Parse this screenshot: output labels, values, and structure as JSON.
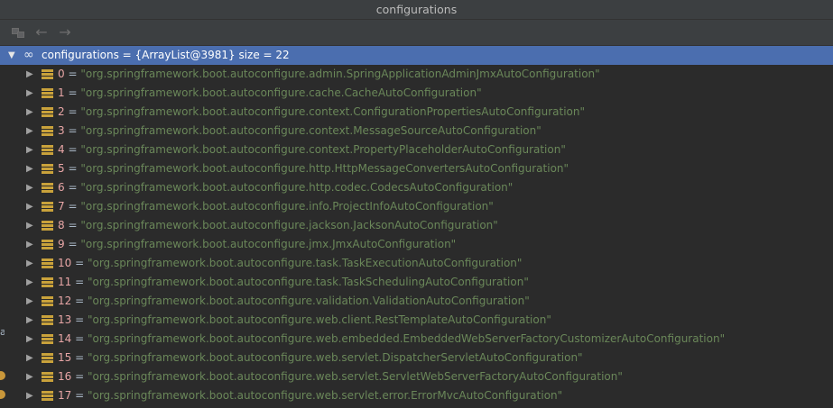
{
  "window": {
    "title": "configurations"
  },
  "toolbar": {
    "icons": [
      "frames-icon",
      "back-arrow-icon",
      "forward-arrow-icon"
    ]
  },
  "root": {
    "expanded": true,
    "label": "configurations = {ArrayList@3981}  size = 22"
  },
  "items": [
    {
      "index": "0",
      "value": "\"org.springframework.boot.autoconfigure.admin.SpringApplicationAdminJmxAutoConfiguration\""
    },
    {
      "index": "1",
      "value": "\"org.springframework.boot.autoconfigure.cache.CacheAutoConfiguration\""
    },
    {
      "index": "2",
      "value": "\"org.springframework.boot.autoconfigure.context.ConfigurationPropertiesAutoConfiguration\""
    },
    {
      "index": "3",
      "value": "\"org.springframework.boot.autoconfigure.context.MessageSourceAutoConfiguration\""
    },
    {
      "index": "4",
      "value": "\"org.springframework.boot.autoconfigure.context.PropertyPlaceholderAutoConfiguration\""
    },
    {
      "index": "5",
      "value": "\"org.springframework.boot.autoconfigure.http.HttpMessageConvertersAutoConfiguration\""
    },
    {
      "index": "6",
      "value": "\"org.springframework.boot.autoconfigure.http.codec.CodecsAutoConfiguration\""
    },
    {
      "index": "7",
      "value": "\"org.springframework.boot.autoconfigure.info.ProjectInfoAutoConfiguration\""
    },
    {
      "index": "8",
      "value": "\"org.springframework.boot.autoconfigure.jackson.JacksonAutoConfiguration\""
    },
    {
      "index": "9",
      "value": "\"org.springframework.boot.autoconfigure.jmx.JmxAutoConfiguration\""
    },
    {
      "index": "10",
      "value": "\"org.springframework.boot.autoconfigure.task.TaskExecutionAutoConfiguration\""
    },
    {
      "index": "11",
      "value": "\"org.springframework.boot.autoconfigure.task.TaskSchedulingAutoConfiguration\""
    },
    {
      "index": "12",
      "value": "\"org.springframework.boot.autoconfigure.validation.ValidationAutoConfiguration\""
    },
    {
      "index": "13",
      "value": "\"org.springframework.boot.autoconfigure.web.client.RestTemplateAutoConfiguration\""
    },
    {
      "index": "14",
      "value": "\"org.springframework.boot.autoconfigure.web.embedded.EmbeddedWebServerFactoryCustomizerAutoConfiguration\""
    },
    {
      "index": "15",
      "value": "\"org.springframework.boot.autoconfigure.web.servlet.DispatcherServletAutoConfiguration\""
    },
    {
      "index": "16",
      "value": "\"org.springframework.boot.autoconfigure.web.servlet.ServletWebServerFactoryAutoConfiguration\""
    },
    {
      "index": "17",
      "value": "\"org.springframework.boot.autoconfigure.web.servlet.error.ErrorMvcAutoConfiguration\""
    }
  ],
  "colors": {
    "background": "#2b2b2b",
    "selection": "#4b6eaf",
    "index": "#e8a6a6",
    "string": "#6a8759",
    "field_icon": "#c9a23b"
  }
}
